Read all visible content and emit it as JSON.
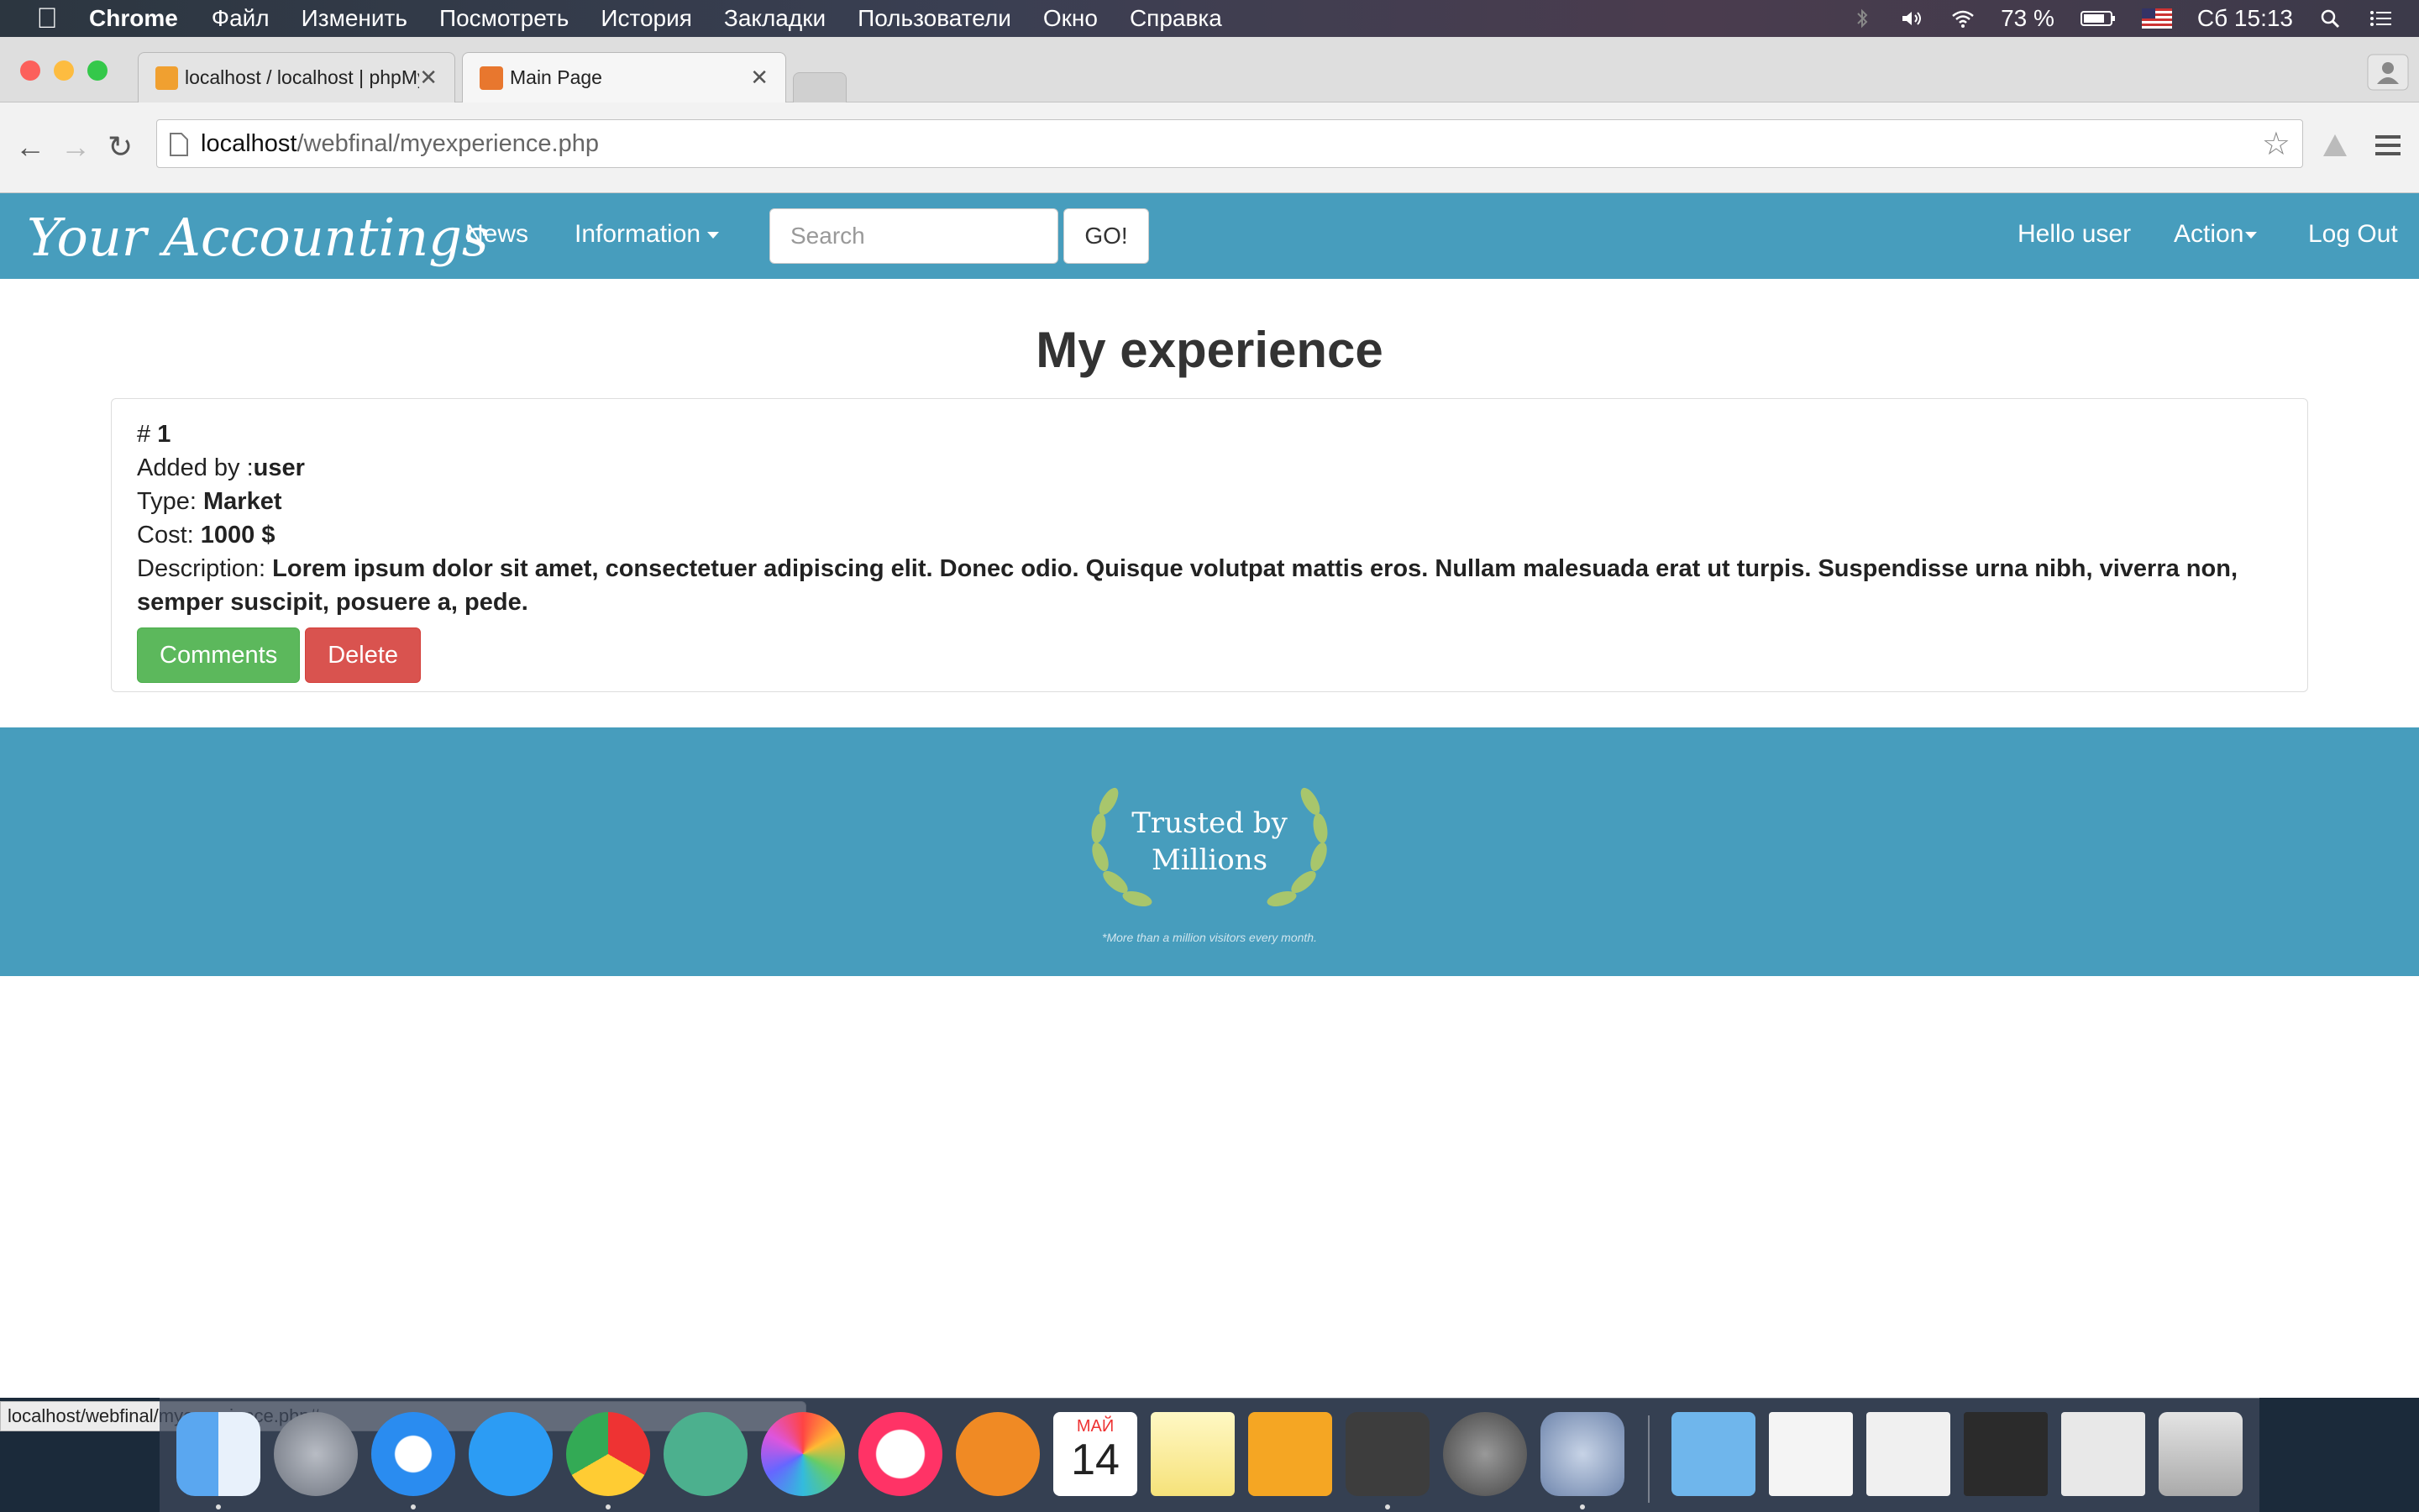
{
  "menubar": {
    "app": "Chrome",
    "items": [
      "Файл",
      "Изменить",
      "Посмотреть",
      "История",
      "Закладки",
      "Пользователи",
      "Окно",
      "Справка"
    ],
    "battery": "73 %",
    "clock": "Сб 15:13"
  },
  "browser": {
    "tabs": [
      {
        "title": "localhost / localhost | phpMy",
        "active": false
      },
      {
        "title": "Main Page",
        "active": true
      }
    ],
    "url_host": "localhost",
    "url_path": "/webfinal/myexperience.php",
    "status_url": "localhost/webfinal/myexperience.php#"
  },
  "navbar": {
    "brand": "Your Accountings",
    "news": "News",
    "information": "Information",
    "search_placeholder": "Search",
    "go": "GO!",
    "greeting": "Hello user",
    "action": "Action",
    "logout": "Log Out"
  },
  "main": {
    "title": "My experience",
    "entry": {
      "id_label": "# ",
      "id": "1",
      "added_label": "Added by :",
      "added_by": "user",
      "type_label": "Type: ",
      "type": "Market",
      "cost_label": "Cost: ",
      "cost": "1000 $",
      "desc_label": "Description: ",
      "description": "Lorem ipsum dolor sit amet, consectetuer adipiscing elit. Donec odio. Quisque volutpat mattis eros. Nullam malesuada erat ut turpis. Suspendisse urna nibh, viverra non, semper suscipit, posuere a, pede.",
      "comments_btn": "Comments",
      "delete_btn": "Delete"
    }
  },
  "footer": {
    "badge_line1": "Trusted by",
    "badge_line2": "Millions",
    "tagline": "*More than a million visitors every month."
  },
  "dock": {
    "calendar_month": "МАЙ",
    "calendar_day": "14"
  },
  "colors": {
    "navbar": "#479dbd",
    "success": "#5cb85c",
    "danger": "#d9534f"
  }
}
